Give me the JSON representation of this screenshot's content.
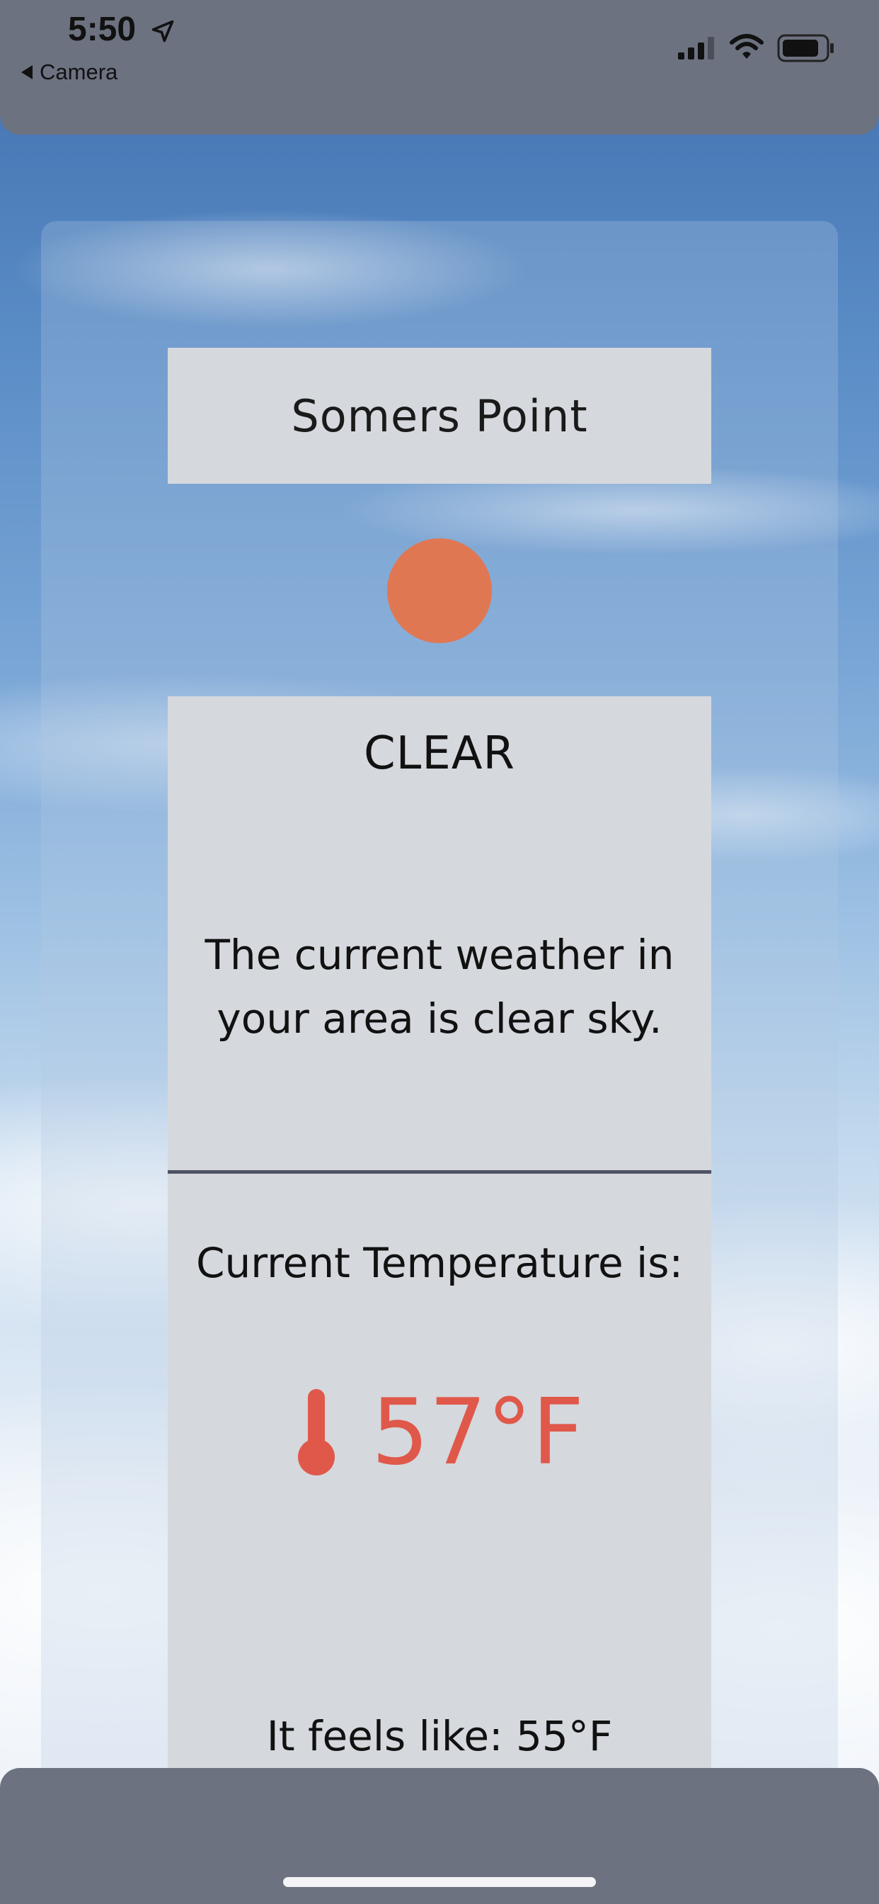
{
  "status_bar": {
    "time": "5:50",
    "back_label": "Camera",
    "location_icon": "location-arrow-icon",
    "signal_icon": "cellular-signal-icon",
    "wifi_icon": "wifi-icon",
    "battery_icon": "battery-icon"
  },
  "weather": {
    "city": "Somers Point",
    "condition": "CLEAR",
    "description": "The current weather in your area is clear sky.",
    "temperature_heading": "Current Temperature is:",
    "temperature": "57°F",
    "feels_like": "It feels like: 55°F",
    "sun_color": "#e07753",
    "temp_color": "#e0584a"
  },
  "colors": {
    "bars": "#6d7280",
    "card": "#d5d8dd",
    "divider": "#4e5463"
  }
}
